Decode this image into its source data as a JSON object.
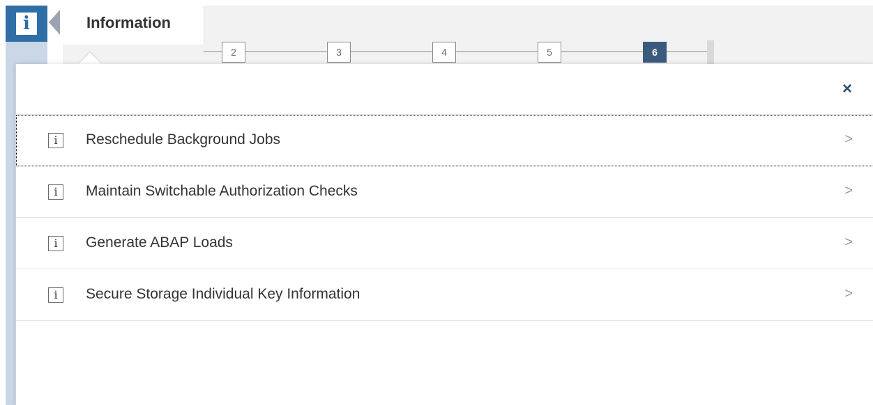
{
  "header": {
    "info_icon_glyph": "i",
    "tab_title": "Information"
  },
  "stepper": {
    "steps": [
      "2",
      "3",
      "4",
      "5",
      "6"
    ],
    "active_step": "6"
  },
  "popover": {
    "close_glyph": "×",
    "items": [
      {
        "icon": "info-icon",
        "icon_glyph": "i",
        "label": "Reschedule Background Jobs",
        "chevron": ">"
      },
      {
        "icon": "info-icon",
        "icon_glyph": "i",
        "label": "Maintain Switchable Authorization Checks",
        "chevron": ">"
      },
      {
        "icon": "info-icon",
        "icon_glyph": "i",
        "label": "Generate ABAP Loads",
        "chevron": ">"
      },
      {
        "icon": "info-icon",
        "icon_glyph": "i",
        "label": "Secure Storage Individual Key Information",
        "chevron": ">"
      }
    ]
  },
  "colors": {
    "brand_blue": "#2f6ea6",
    "active_step": "#3b5b7e",
    "close_icon": "#2f4f72"
  }
}
